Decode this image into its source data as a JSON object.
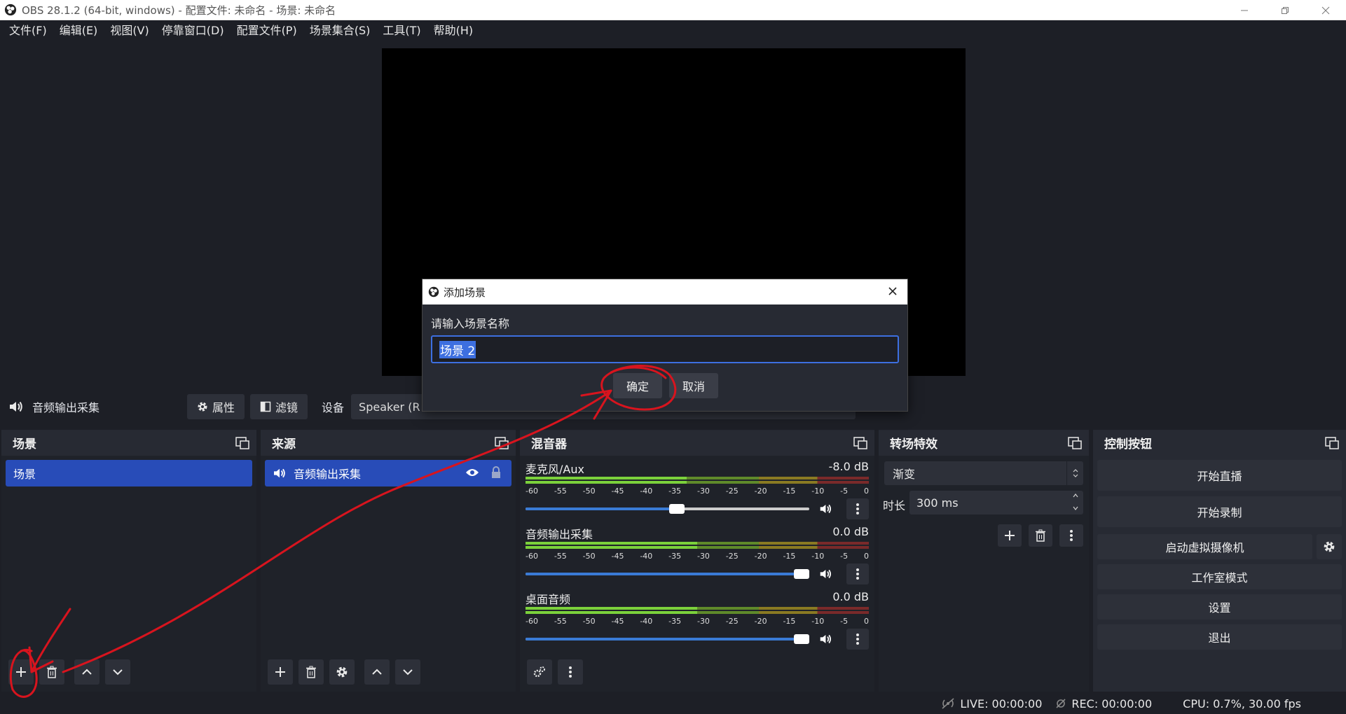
{
  "window": {
    "title": "OBS 28.1.2 (64-bit, windows) - 配置文件: 未命名 - 场景: 未命名",
    "minimize_icon": "minimize-icon",
    "restore_icon": "restore-icon",
    "close_icon": "close-icon"
  },
  "menu": [
    "文件(F)",
    "编辑(E)",
    "视图(V)",
    "停靠窗口(D)",
    "配置文件(P)",
    "场景集合(S)",
    "工具(T)",
    "帮助(H)"
  ],
  "context_bar": {
    "source_name": "音频输出采集",
    "properties_label": "属性",
    "filters_label": "滤镜",
    "device_label": "设备",
    "device_value": "Speaker (R"
  },
  "docks": {
    "scenes": {
      "title": "场景",
      "items": [
        "场景"
      ]
    },
    "sources": {
      "title": "来源",
      "items": [
        "音频输出采集"
      ]
    },
    "mixer": {
      "title": "混音器",
      "ticks": [
        "-60",
        "-55",
        "-50",
        "-45",
        "-40",
        "-35",
        "-30",
        "-25",
        "-20",
        "-15",
        "-10",
        "-5",
        "0"
      ],
      "channels": [
        {
          "name": "麦克风/Aux",
          "db": "-8.0 dB",
          "volume": 0.56,
          "level": 0.47
        },
        {
          "name": "音频输出采集",
          "db": "0.0 dB",
          "volume": 1.0,
          "level": 0.5
        },
        {
          "name": "桌面音频",
          "db": "0.0 dB",
          "volume": 1.0,
          "level": 0.5
        }
      ]
    },
    "transitions": {
      "title": "转场特效",
      "selected": "渐变",
      "duration_label": "时长",
      "duration_value": "300 ms"
    },
    "controls": {
      "title": "控制按钮",
      "start_streaming": "开始直播",
      "start_recording": "开始录制",
      "start_virtual_cam": "启动虚拟摄像机",
      "studio_mode": "工作室模式",
      "settings": "设置",
      "exit": "退出"
    }
  },
  "status": {
    "live": "LIVE: 00:00:00",
    "rec": "REC: 00:00:00",
    "cpu": "CPU: 0.7%, 30.00 fps"
  },
  "dialog": {
    "title": "添加场景",
    "prompt": "请输入场景名称",
    "input_value": "场景 2",
    "ok_label": "确定",
    "cancel_label": "取消"
  },
  "colors": {
    "background": "#1d1f26",
    "panel": "#272a33",
    "selection": "#284cb8",
    "annotation": "#d8141e"
  }
}
